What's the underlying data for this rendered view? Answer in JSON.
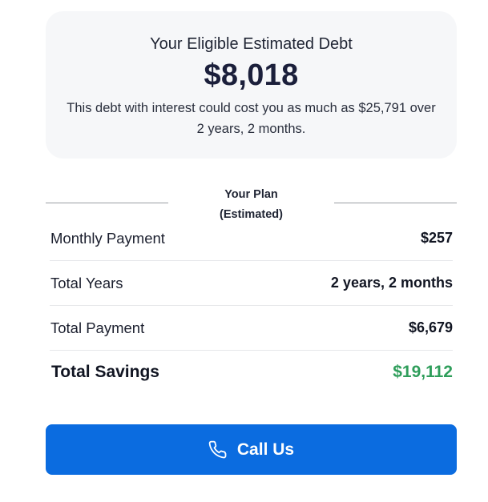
{
  "debt": {
    "title": "Your Eligible Estimated Debt",
    "amount": "$8,018",
    "description": "This debt with interest could cost you as much as $25,791 over 2 years, 2 months."
  },
  "plan": {
    "title_line1": "Your Plan",
    "title_line2": "(Estimated)",
    "rows": [
      {
        "label": "Monthly Payment",
        "value": "$257"
      },
      {
        "label": "Total Years",
        "value": "2 years, 2 months"
      },
      {
        "label": "Total Payment",
        "value": "$6,679"
      }
    ],
    "savings": {
      "label": "Total Savings",
      "value": "$19,112"
    }
  },
  "cta": {
    "label": "Call Us",
    "icon": "phone-icon"
  },
  "colors": {
    "accent": "#0b6ce0",
    "savings": "#2f9e5b",
    "card_bg": "#f6f7f9"
  }
}
